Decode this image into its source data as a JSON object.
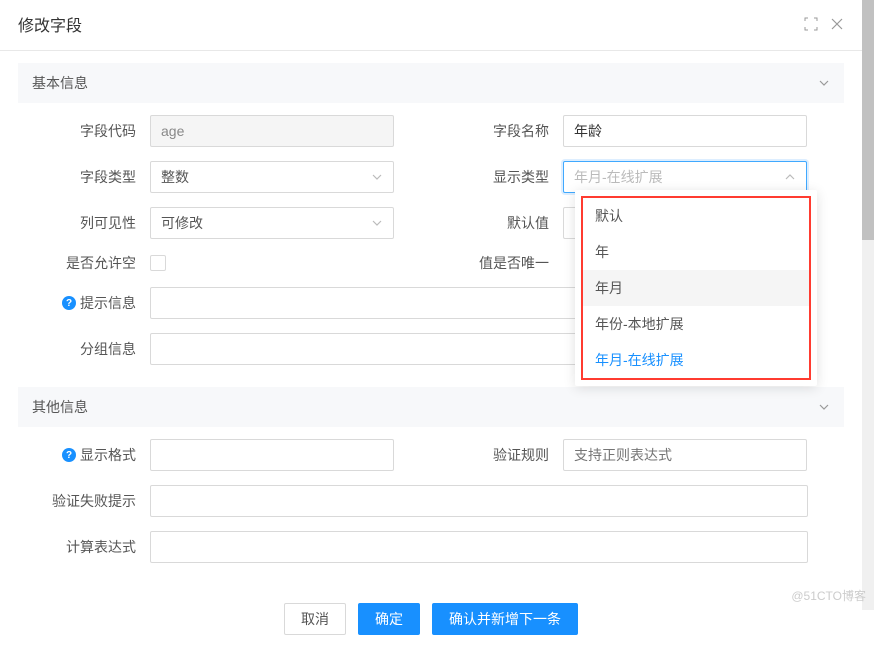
{
  "header": {
    "title": "修改字段"
  },
  "sections": {
    "basic": "基本信息",
    "other": "其他信息"
  },
  "labels": {
    "field_code": "字段代码",
    "field_name": "字段名称",
    "field_type": "字段类型",
    "display_type": "显示类型",
    "col_visibility": "列可见性",
    "default_value": "默认值",
    "allow_null": "是否允许空",
    "is_unique": "值是否唯一",
    "hint_info": "提示信息",
    "group_info": "分组信息",
    "display_format": "显示格式",
    "validate_rule": "验证规则",
    "validate_fail_hint": "验证失败提示",
    "calc_expression": "计算表达式"
  },
  "values": {
    "field_code": "age",
    "field_name": "年龄",
    "field_type": "整数",
    "display_type": "年月-在线扩展",
    "col_visibility": "可修改",
    "validate_rule_placeholder": "支持正则表达式"
  },
  "dropdown": {
    "options": [
      "默认",
      "年",
      "年月",
      "年份-本地扩展",
      "年月-在线扩展"
    ]
  },
  "footer": {
    "cancel": "取消",
    "confirm": "确定",
    "confirm_next": "确认并新增下一条"
  },
  "watermark": "@51CTO博客"
}
